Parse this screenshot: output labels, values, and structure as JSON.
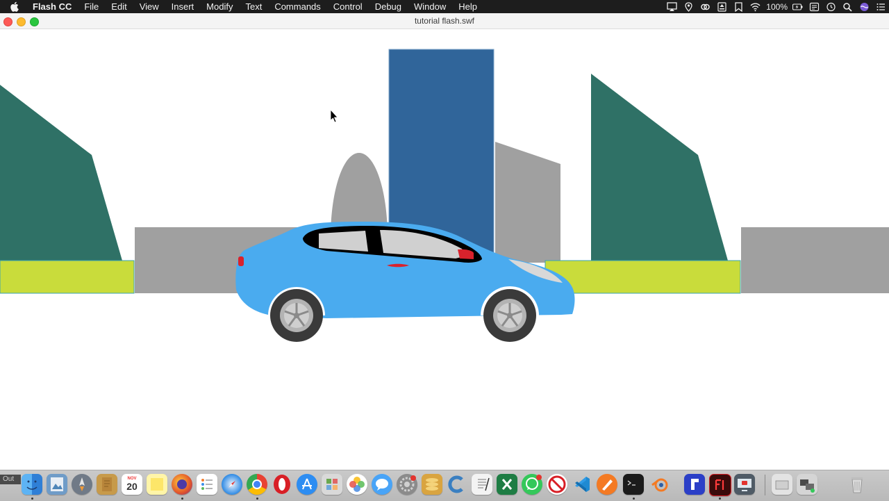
{
  "menubar": {
    "app_name": "Flash CC",
    "items": [
      "File",
      "Edit",
      "View",
      "Insert",
      "Modify",
      "Text",
      "Commands",
      "Control",
      "Debug",
      "Window",
      "Help"
    ],
    "battery_percent": "100%"
  },
  "window": {
    "title": "tutorial flash.swf"
  },
  "dock": {
    "terminal_tag": "Out",
    "calendar": {
      "month": "NOV",
      "day": "20"
    },
    "apps": [
      "Finder",
      "Preview",
      "Launchpad",
      "Notes",
      "Calendar",
      "Stickies",
      "Firefox",
      "Reminders",
      "Safari",
      "Chrome",
      "Opera",
      "App Store",
      "Photo Booth",
      "Photos",
      "Messages",
      "System Preferences",
      "Stacks",
      "C",
      "TextEdit",
      "Excel",
      "WhatsApp",
      "No Entry",
      "VS Code",
      "Vectorize",
      "Terminal",
      "Blender",
      "Frame",
      "Flash",
      "Screen Recorder",
      "Downloads",
      "Applications",
      "Trash"
    ]
  },
  "colors": {
    "sky": "#ffffff",
    "teal_building": "#2f7166",
    "blue_tower": "#30659a",
    "gray_building": "#a0a0a0",
    "lime_wall": "#c9dc3b",
    "car_body": "#4aabef",
    "car_window": "#d0d0d0",
    "car_trim": "#000000",
    "tail_light": "#d9222c",
    "tire": "#3a3a3a",
    "rim": "#b3b3b3"
  }
}
